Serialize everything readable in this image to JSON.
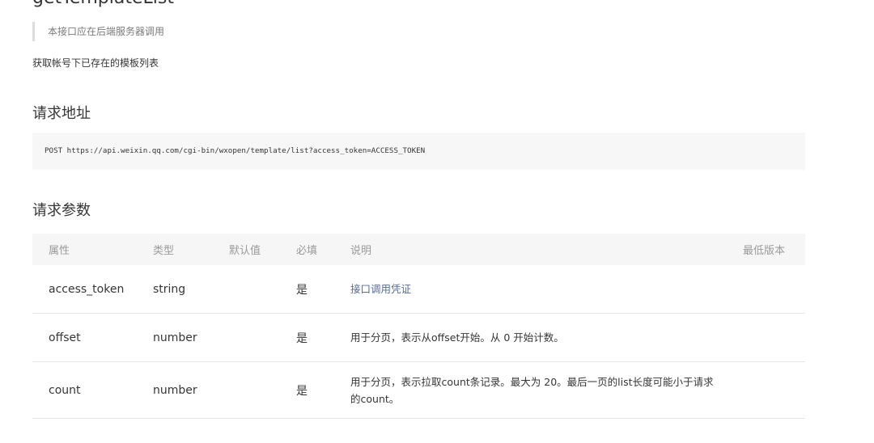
{
  "doc": {
    "title": "getTemplateList",
    "note": "本接口应在后端服务器调用",
    "description": "获取帐号下已存在的模板列表"
  },
  "request_url": {
    "heading": "请求地址",
    "code": "POST https://api.weixin.qq.com/cgi-bin/wxopen/template/list?access_token=ACCESS_TOKEN"
  },
  "params": {
    "heading": "请求参数",
    "columns": [
      "属性",
      "类型",
      "默认值",
      "必填",
      "说明",
      "最低版本"
    ],
    "rows": [
      {
        "name": "access_token",
        "type": "string",
        "default": "",
        "required": "是",
        "desc": "接口调用凭证",
        "min_version": ""
      },
      {
        "name": "offset",
        "type": "number",
        "default": "",
        "required": "是",
        "desc": "用于分页，表示从offset开始。从 0 开始计数。",
        "min_version": ""
      },
      {
        "name": "count",
        "type": "number",
        "default": "",
        "required": "是",
        "desc": "用于分页，表示拉取count条记录。最大为 20。最后一页的list长度可能小于请求的count。",
        "min_version": ""
      }
    ]
  },
  "colors": {
    "text": "#353535",
    "muted": "#9a9a9a",
    "link": "#576b95",
    "code_bg": "#f7f7f7",
    "header_bg": "#f6f6f6"
  }
}
